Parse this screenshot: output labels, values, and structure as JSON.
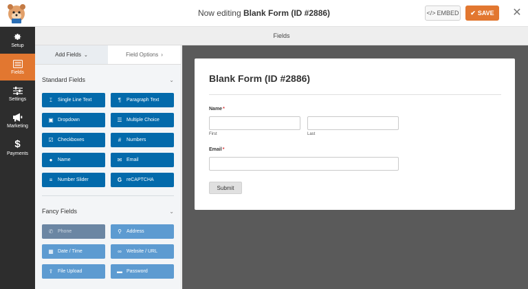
{
  "header": {
    "title_prefix": "Now editing",
    "title_form": "Blank Form (ID #2886)",
    "embed_label": "EMBED",
    "save_label": "SAVE",
    "close_icon": "close-icon",
    "accent_color": "#e27730"
  },
  "sidebar": {
    "items": [
      {
        "label": "Setup",
        "icon": "gear-icon",
        "active": false
      },
      {
        "label": "Fields",
        "icon": "list-icon",
        "active": true
      },
      {
        "label": "Settings",
        "icon": "sliders-icon",
        "active": false
      },
      {
        "label": "Marketing",
        "icon": "megaphone-icon",
        "active": false
      },
      {
        "label": "Payments",
        "icon": "dollar-icon",
        "active": false
      }
    ]
  },
  "panel": {
    "title": "Fields",
    "tabs": [
      {
        "label": "Add Fields",
        "icon": "chevron-down-icon",
        "active": true
      },
      {
        "label": "Field Options",
        "icon": "chevron-right-icon",
        "active": false
      }
    ],
    "standard": {
      "title": "Standard Fields",
      "items": [
        {
          "label": "Single Line Text",
          "icon": "text-icon"
        },
        {
          "label": "Paragraph Text",
          "icon": "paragraph-icon"
        },
        {
          "label": "Dropdown",
          "icon": "dropdown-icon"
        },
        {
          "label": "Multiple Choice",
          "icon": "list-icon"
        },
        {
          "label": "Checkboxes",
          "icon": "checkbox-icon"
        },
        {
          "label": "Numbers",
          "icon": "hash-icon"
        },
        {
          "label": "Name",
          "icon": "user-icon"
        },
        {
          "label": "Email",
          "icon": "envelope-icon"
        },
        {
          "label": "Number Slider",
          "icon": "sliders-icon"
        },
        {
          "label": "reCAPTCHA",
          "icon": "google-icon"
        }
      ]
    },
    "fancy": {
      "title": "Fancy Fields",
      "items": [
        {
          "label": "Phone",
          "icon": "phone-icon"
        },
        {
          "label": "Address",
          "icon": "map-marker-icon"
        },
        {
          "label": "Date / Time",
          "icon": "calendar-icon"
        },
        {
          "label": "Website / URL",
          "icon": "link-icon"
        },
        {
          "label": "File Upload",
          "icon": "upload-icon"
        },
        {
          "label": "Password",
          "icon": "lock-icon"
        }
      ]
    }
  },
  "form": {
    "title": "Blank Form (ID #2886)",
    "name_label": "Name",
    "first_sublabel": "First",
    "last_sublabel": "Last",
    "email_label": "Email",
    "required_mark": "*",
    "submit_label": "Submit"
  }
}
